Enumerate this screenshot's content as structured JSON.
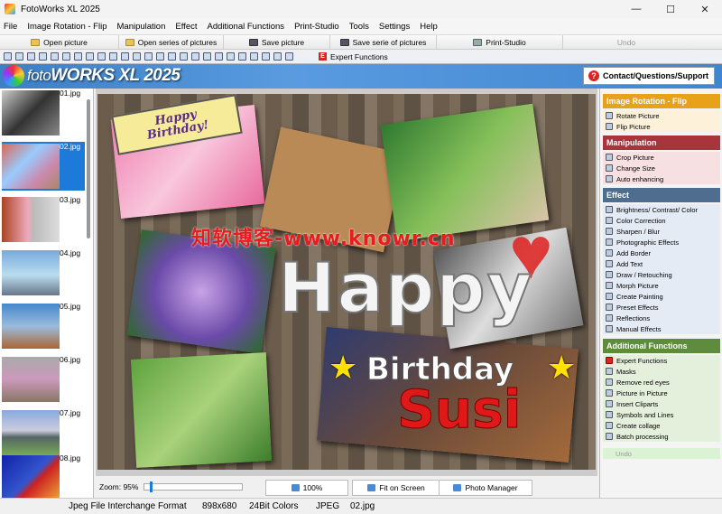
{
  "window": {
    "title": "FotoWorks XL 2025",
    "controls": {
      "minimize": "—",
      "maximize": "☐",
      "close": "✕"
    }
  },
  "menu": [
    "File",
    "Image Rotation - Flip",
    "Manipulation",
    "Effect",
    "Additional Functions",
    "Print-Studio",
    "Tools",
    "Settings",
    "Help"
  ],
  "toolbar": {
    "open_picture": "Open picture",
    "open_series": "Open series of pictures",
    "save_picture": "Save picture",
    "save_serie": "Save serie of pictures",
    "print_studio": "Print-Studio",
    "undo": "Undo",
    "expert": "Expert Functions",
    "expert_glyph": "E"
  },
  "banner": {
    "logo_foto": "foto",
    "logo_works": "WORKS",
    "logo_xl": "XL",
    "logo_year": "2025",
    "contact": "Contact/Questions/Support",
    "contact_glyph": "?"
  },
  "thumbnails": [
    {
      "label": "01.jpg",
      "selected": false
    },
    {
      "label": "02.jpg",
      "selected": true
    },
    {
      "label": "03.jpg",
      "selected": false
    },
    {
      "label": "04.jpg",
      "selected": false
    },
    {
      "label": "05.jpg",
      "selected": false
    },
    {
      "label": "06.jpg",
      "selected": false
    },
    {
      "label": "07.jpg",
      "selected": false
    },
    {
      "label": "08.jpg",
      "selected": false
    }
  ],
  "image": {
    "watermark": "知软博客-www.knowr.cn",
    "happy_text": "Happy",
    "birthday_text": "Birthday",
    "name_text": "Susi",
    "card_line1": "Happy",
    "card_line2": "Birthday!",
    "star_glyph": "★",
    "heart_glyph": "♥"
  },
  "bottom": {
    "zoom_label": "Zoom: 95%",
    "zoom_level_pct": 95,
    "btn_100": "100%",
    "btn_fit": "Fit on Screen",
    "btn_manager": "Photo Manager"
  },
  "panel": {
    "sections": [
      {
        "title": "Image Rotation - Flip",
        "color": "#e8a21a",
        "items_bg": "#fdf1d9",
        "items": [
          "Rotate Picture",
          "Flip Picture"
        ]
      },
      {
        "title": "Manipulation",
        "color": "#a8353c",
        "items_bg": "#f7e0e2",
        "items": [
          "Crop Picture",
          "Change Size",
          "Auto enhancing"
        ]
      },
      {
        "title": "Effect",
        "color": "#4f6d8f",
        "items_bg": "#e4ebf4",
        "items": [
          "Brightness/ Contrast/ Color",
          "Color Correction",
          "Sharpen / Blur",
          "Photographic Effects",
          "Add Border",
          "Add Text",
          "Draw / Retouching",
          "Morph Picture",
          "Create Painting",
          "Preset Effects",
          "Reflections",
          "Manual Effects"
        ]
      },
      {
        "title": "Additional Functions",
        "color": "#5d8c3c",
        "items_bg": "#e5f0dc",
        "items": [
          "Expert Functions",
          "Masks",
          "Remove red eyes",
          "Picture in Picture",
          "Insert Cliparts",
          "Symbols and Lines",
          "Create collage",
          "Batch processing"
        ]
      }
    ],
    "undo": "Undo"
  },
  "status": {
    "format": "Jpeg File Interchange Format",
    "dimensions": "898x680",
    "colors": "24Bit Colors",
    "type": "JPEG",
    "file": "02.jpg"
  }
}
